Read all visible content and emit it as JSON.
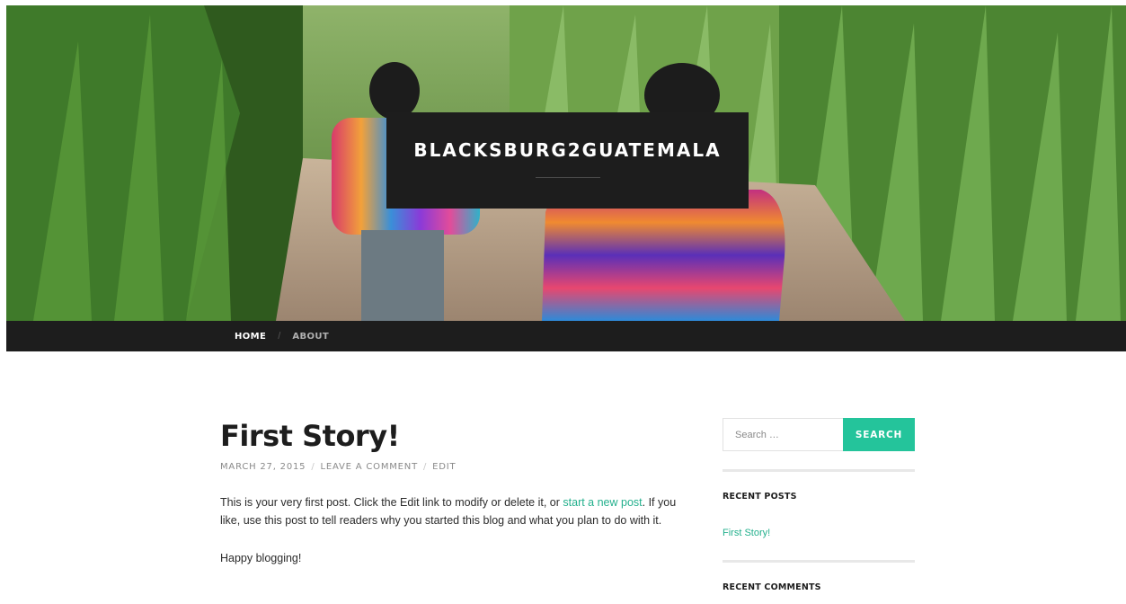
{
  "site": {
    "title": "BLACKSBURG2GUATEMALA"
  },
  "colors": {
    "accent": "#24c49b",
    "dark": "#1d1d1d",
    "link": "#24b08d"
  },
  "nav": {
    "items": [
      {
        "label": "HOME",
        "active": true
      },
      {
        "label": "ABOUT",
        "active": false
      }
    ]
  },
  "post": {
    "title": "First Story!",
    "date": "MARCH 27, 2015",
    "comment_link": "LEAVE A COMMENT",
    "edit_link": "EDIT",
    "body_before_link": "This is your very first post. Click the Edit link to modify or delete it, or ",
    "body_link": "start a new post",
    "body_after_link": ". If you like, use this post to tell readers why you started this blog and what you plan to do with it.",
    "closing": "Happy blogging!"
  },
  "sidebar": {
    "search": {
      "placeholder": "Search …",
      "button_label": "SEARCH"
    },
    "recent_posts": {
      "title": "RECENT POSTS",
      "items": [
        "First Story!"
      ]
    },
    "recent_comments": {
      "title": "RECENT COMMENTS"
    }
  }
}
